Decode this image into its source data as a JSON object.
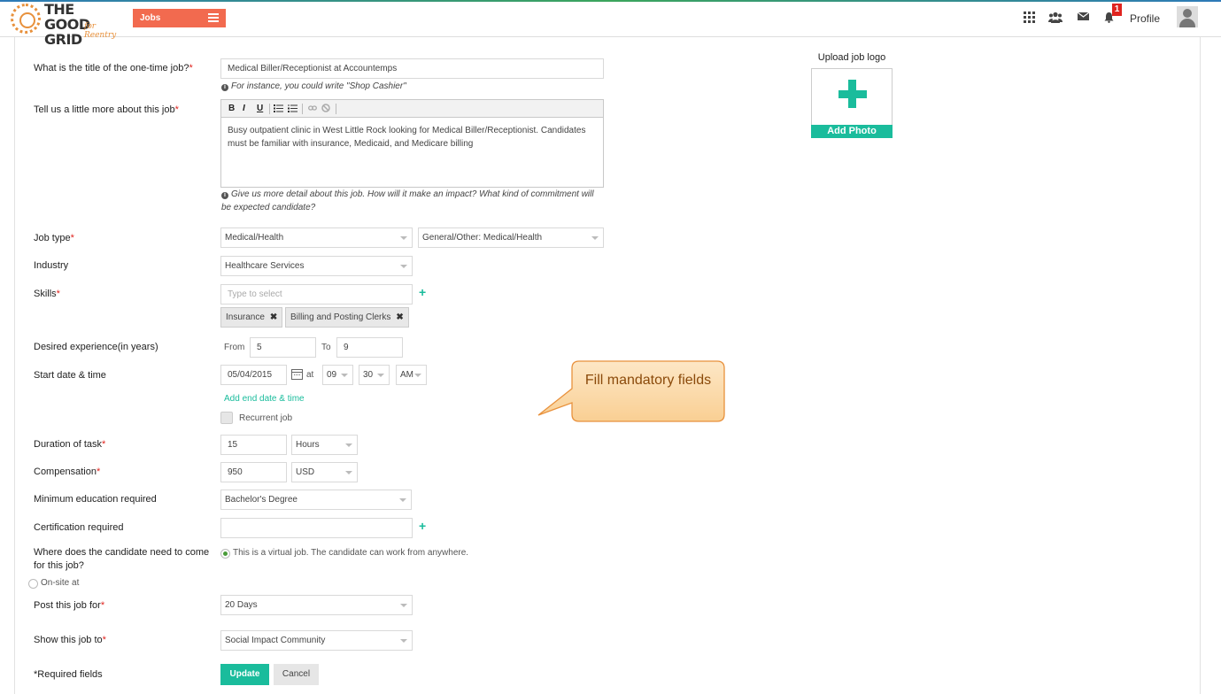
{
  "header": {
    "logo_line1": "THE GOOD",
    "logo_line2": "GRID",
    "logo_sub": "for Reentry",
    "jobs_label": "Jobs",
    "notification_count": "1",
    "profile_label": "Profile"
  },
  "form": {
    "title_label": "What is the title of the one-time job?",
    "title_value": "Medical Biller/Receptionist at Accountemps",
    "title_hint": "For instance, you could write \"Shop Cashier\"",
    "description_label": "Tell us a little more about this job",
    "description_value": "Busy outpatient clinic in West Little Rock looking for Medical Biller/Receptionist. Candidates must be familiar with insurance, Medicaid, and Medicare billing",
    "description_hint": "Give us more detail about this job. How will it make an impact? What kind of commitment will be expected candidate?",
    "editor_toolbar": {
      "bold": "B",
      "italic": "I",
      "underline": "U"
    },
    "job_type_label": "Job type",
    "job_type_value": "Medical/Health",
    "job_subtype_value": "General/Other: Medical/Health",
    "industry_label": "Industry",
    "industry_value": "Healthcare Services",
    "skills_label": "Skills",
    "skills_placeholder": "Type to select",
    "skills_tags": [
      "Insurance",
      "Billing and Posting Clerks"
    ],
    "experience_label": "Desired experience(in years)",
    "experience_from_label": "From",
    "experience_from": "5",
    "experience_to_label": "To",
    "experience_to": "9",
    "start_label": "Start date & time",
    "start_date": "05/04/2015",
    "at_label": "at",
    "start_hour": "09",
    "start_minute": "30",
    "start_ampm": "AM",
    "add_end_date": "Add end date & time",
    "recurrent_label": "Recurrent job",
    "duration_label": "Duration of task",
    "duration_value": "15",
    "duration_unit": "Hours",
    "compensation_label": "Compensation",
    "compensation_value": "950",
    "compensation_currency": "USD",
    "education_label": "Minimum education required",
    "education_value": "Bachelor's Degree",
    "certification_label": "Certification required",
    "certification_value": "",
    "location_label": "Where does the candidate need to come for this job?",
    "virtual_option": "This is a virtual job. The candidate can work from anywhere.",
    "onsite_option": "On-site at",
    "post_for_label": "Post this job for",
    "post_for_value": "20 Days",
    "show_to_label": "Show this job to",
    "show_to_value": "Social Impact Community",
    "required_note": "*Required fields",
    "update_label": "Update",
    "cancel_label": "Cancel",
    "required_marker": "*"
  },
  "upload": {
    "title": "Upload job logo",
    "button": "Add Photo"
  },
  "callout": {
    "text": "Fill mandatory fields"
  },
  "colors": {
    "accent": "#1abc9c",
    "jobs_button": "#f26a4f",
    "required": "#e0241f",
    "callout_fill": "#fbd9a8",
    "callout_border": "#e8913c"
  },
  "icons": {
    "nav": [
      "apps-grid-icon",
      "community-icon",
      "mail-icon",
      "bell-icon",
      "user-avatar-icon"
    ]
  }
}
